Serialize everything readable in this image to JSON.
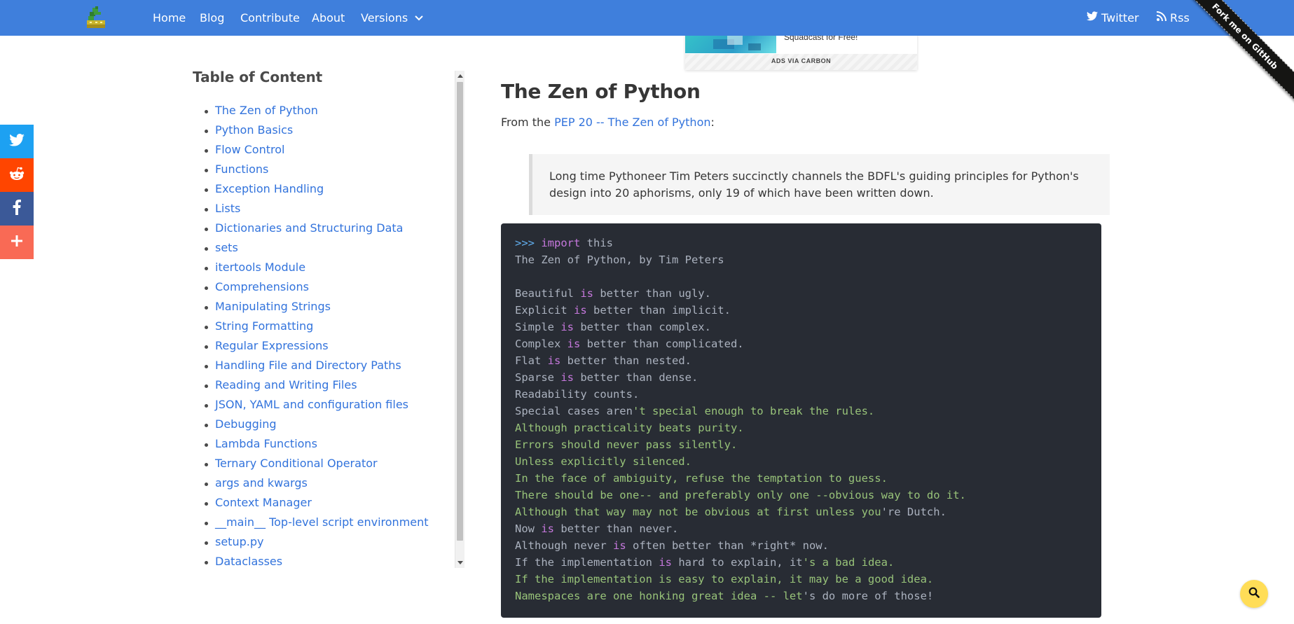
{
  "navbar": {
    "logo_icon": "python-logo-icon",
    "links": {
      "home": "Home",
      "blog": "Blog",
      "contribute": "Contribute",
      "about": "About",
      "versions": "Versions"
    },
    "right": {
      "twitter": "Twitter",
      "rss": "Rss"
    },
    "background_color": "#3f7fdc"
  },
  "ribbon": {
    "label": "Fork me on GitHub"
  },
  "share": {
    "icons": [
      "twitter-icon",
      "reddit-icon",
      "facebook-icon",
      "plus-icon"
    ],
    "colors": {
      "twitter": "#1da1f2",
      "reddit": "#ff4500",
      "facebook": "#3b5998",
      "more": "#f96a55"
    }
  },
  "ad": {
    "text": "Squadcast for Free!",
    "powered_by": "ADS VIA CARBON"
  },
  "toc": {
    "title": "Table of Content",
    "items": [
      "The Zen of Python",
      "Python Basics",
      "Flow Control",
      "Functions",
      "Exception Handling",
      "Lists",
      "Dictionaries and Structuring Data",
      "sets",
      "itertools Module",
      "Comprehensions",
      "Manipulating Strings",
      "String Formatting",
      "Regular Expressions",
      "Handling File and Directory Paths",
      "Reading and Writing Files",
      "JSON, YAML and configuration files",
      "Debugging",
      "Lambda Functions",
      "Ternary Conditional Operator",
      "args and kwargs",
      "Context Manager",
      "__main__ Top-level script environment",
      "setup.py",
      "Dataclasses"
    ]
  },
  "article": {
    "title": "The Zen of Python",
    "intro_prefix": "From the ",
    "intro_link": "PEP 20 -- The Zen of Python",
    "intro_suffix": ":",
    "quote": "Long time Pythoneer Tim Peters succinctly channels the BDFL's guiding principles for Python's design into 20 aphorisms, only 19 of which have been written down.",
    "code": {
      "prompt": ">>> ",
      "import_kw": "import",
      "import_rest": " this",
      "lines": [
        {
          "segments": [
            {
              "t": "The Zen of Python, by Tim Peters",
              "k": "plain"
            }
          ]
        },
        {
          "segments": [
            {
              "t": "",
              "k": "plain"
            }
          ]
        },
        {
          "segments": [
            {
              "t": "Beautiful ",
              "k": "plain"
            },
            {
              "t": "is",
              "k": "keyword"
            },
            {
              "t": " better than ugly.",
              "k": "plain"
            }
          ]
        },
        {
          "segments": [
            {
              "t": "Explicit ",
              "k": "plain"
            },
            {
              "t": "is",
              "k": "keyword"
            },
            {
              "t": " better than implicit.",
              "k": "plain"
            }
          ]
        },
        {
          "segments": [
            {
              "t": "Simple ",
              "k": "plain"
            },
            {
              "t": "is",
              "k": "keyword"
            },
            {
              "t": " better than complex.",
              "k": "plain"
            }
          ]
        },
        {
          "segments": [
            {
              "t": "Complex ",
              "k": "plain"
            },
            {
              "t": "is",
              "k": "keyword"
            },
            {
              "t": " better than complicated.",
              "k": "plain"
            }
          ]
        },
        {
          "segments": [
            {
              "t": "Flat ",
              "k": "plain"
            },
            {
              "t": "is",
              "k": "keyword"
            },
            {
              "t": " better than nested.",
              "k": "plain"
            }
          ]
        },
        {
          "segments": [
            {
              "t": "Sparse ",
              "k": "plain"
            },
            {
              "t": "is",
              "k": "keyword"
            },
            {
              "t": " better than dense.",
              "k": "plain"
            }
          ]
        },
        {
          "segments": [
            {
              "t": "Readability counts.",
              "k": "plain"
            }
          ]
        },
        {
          "segments": [
            {
              "t": "Special cases aren",
              "k": "plain"
            },
            {
              "t": "'t special enough to break the rules.",
              "k": "string"
            }
          ]
        },
        {
          "segments": [
            {
              "t": "Although practicality beats purity.",
              "k": "string"
            }
          ]
        },
        {
          "segments": [
            {
              "t": "Errors should never pass silently.",
              "k": "string"
            }
          ]
        },
        {
          "segments": [
            {
              "t": "Unless explicitly silenced.",
              "k": "string"
            }
          ]
        },
        {
          "segments": [
            {
              "t": "In the face of ambiguity, refuse the temptation to guess.",
              "k": "string"
            }
          ]
        },
        {
          "segments": [
            {
              "t": "There should be one-- and preferably only one --obvious way to do it.",
              "k": "string"
            }
          ]
        },
        {
          "segments": [
            {
              "t": "Although that way may not be obvious at first unless you",
              "k": "string"
            },
            {
              "t": "'re Dutch.",
              "k": "plain"
            }
          ]
        },
        {
          "segments": [
            {
              "t": "Now ",
              "k": "plain"
            },
            {
              "t": "is",
              "k": "keyword"
            },
            {
              "t": " better than never.",
              "k": "plain"
            }
          ]
        },
        {
          "segments": [
            {
              "t": "Although never ",
              "k": "plain"
            },
            {
              "t": "is",
              "k": "keyword"
            },
            {
              "t": " often better than *right* now.",
              "k": "plain"
            }
          ]
        },
        {
          "segments": [
            {
              "t": "If the implementation ",
              "k": "plain"
            },
            {
              "t": "is",
              "k": "keyword"
            },
            {
              "t": " hard to explain, it",
              "k": "plain"
            },
            {
              "t": "'s a bad idea.",
              "k": "string"
            }
          ]
        },
        {
          "segments": [
            {
              "t": "If the implementation is easy to explain, it may be a good idea.",
              "k": "string"
            }
          ]
        },
        {
          "segments": [
            {
              "t": "Namespaces are one honking great idea -- let",
              "k": "string"
            },
            {
              "t": "'s do more of those!",
              "k": "plain"
            }
          ]
        }
      ],
      "colors": {
        "background": "#282c34",
        "plain": "#abb2bf",
        "keyword": "#c678dd",
        "string": "#98c379",
        "prompt": "#61aeee"
      }
    }
  },
  "search": {
    "icon": "search-icon",
    "color": "#ffdd57"
  }
}
